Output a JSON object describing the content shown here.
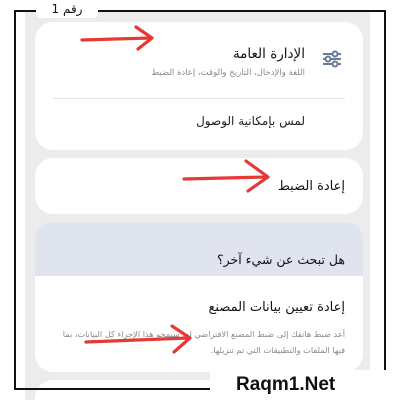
{
  "badge": {
    "text": "رقم 1"
  },
  "general_management": {
    "title": "الإدارة العامة",
    "subtitle": "اللغة والإدخال، التاريخ والوقت، إعادة الضبط",
    "next_item_partial": "لمس بإمكانية الوصول"
  },
  "reset": {
    "title": "إعادة الضبط"
  },
  "looking_for": {
    "title": "هل تبحث عن شيء آخر؟"
  },
  "factory_reset": {
    "title": "إعادة تعيين بيانات المصنع",
    "description": "أعد ضبط هاتفك إلى ضبط المصنع الافتراضي له. سيمحو هذا الإجراء كل البيانات، بما فيها الملفات والتطبيقات التي تم تنزيلها."
  },
  "watermark": {
    "text": "Raqm1.Net"
  },
  "colors": {
    "annotation_arrow": "#e53935",
    "frame": "#111111",
    "highlight_card": "#dfe4ee"
  },
  "icons": {
    "settings": "sliders-icon"
  }
}
